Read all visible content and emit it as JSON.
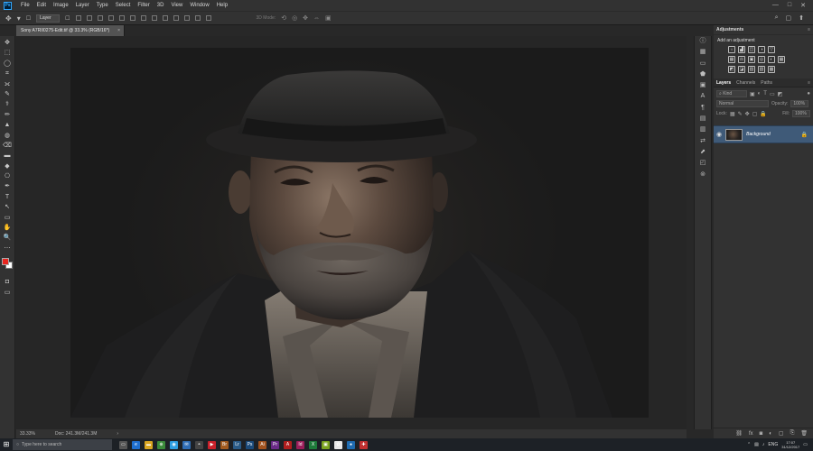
{
  "menubar": {
    "logo": "Ps",
    "items": [
      "File",
      "Edit",
      "Image",
      "Layer",
      "Type",
      "Select",
      "Filter",
      "3D",
      "View",
      "Window",
      "Help"
    ],
    "window_controls": [
      "—",
      "□",
      "✕"
    ]
  },
  "optionsbar": {
    "layer_select": "Layer",
    "mode_3d": "3D Mode:",
    "right_icons": [
      "⌕",
      "▢",
      "⬆"
    ]
  },
  "document": {
    "tab_title": "Sony A7RII0275-Edit.tif @ 33.3% (RGB/16*)",
    "close_glyph": "×",
    "zoom": "33.33%",
    "doc_info": "Doc: 241.3M/241.3M",
    "status_arrow": "›"
  },
  "tools": [
    "✥",
    "⬚",
    "◯",
    "⌗",
    "⟗",
    "✎",
    "⚕",
    "✏",
    "▲",
    "◍",
    "⌫",
    "▬",
    "◆",
    "⎔",
    "✒",
    "T",
    "↖",
    "▭",
    "✋",
    "🔍",
    "⋯"
  ],
  "strip_icons": [
    "ⓘ",
    "▦",
    "▭",
    "⬟",
    "▣",
    "A",
    "¶",
    "▤",
    "▥",
    "⇄",
    "⬈",
    "◰",
    "⊚"
  ],
  "adjustments": {
    "header": "Adjustments",
    "subtitle": "Add an adjustment",
    "row1": [
      "☼",
      "▟",
      "◫",
      "◑",
      "▽"
    ],
    "row2": [
      "▦",
      "⚖",
      "▣",
      "◎",
      "◐",
      "▦"
    ],
    "row3": [
      "◩",
      "◪",
      "▨",
      "▧",
      "▩"
    ]
  },
  "layers": {
    "tabs": [
      "Layers",
      "Channels",
      "Paths"
    ],
    "filter_kind": "⌕ Kind",
    "blend_mode": "Normal",
    "opacity_label": "Opacity:",
    "opacity_value": "100%",
    "lock_label": "Lock:",
    "fill_label": "Fill:",
    "fill_value": "100%",
    "layer_name": "Background",
    "footer_icons": [
      "⛓",
      "fx",
      "◙",
      "◐",
      "▢",
      "⎘",
      "🗑"
    ]
  },
  "taskbar": {
    "start": "⊞",
    "search_placeholder": "Type here to search",
    "search_icon": "○",
    "apps": [
      {
        "label": "▭",
        "color": "#555"
      },
      {
        "label": "e",
        "color": "#1e6fd0"
      },
      {
        "label": "▬",
        "color": "#d9a520"
      },
      {
        "label": "⊕",
        "color": "#3a8a3a"
      },
      {
        "label": "◉",
        "color": "#2e9de0"
      },
      {
        "label": "✉",
        "color": "#2f6db5"
      },
      {
        "label": "◓",
        "color": "#444"
      },
      {
        "label": "▶",
        "color": "#c8202a"
      },
      {
        "label": "Br",
        "color": "#a05a1e"
      },
      {
        "label": "Lr",
        "color": "#2a5a86"
      },
      {
        "label": "Ps",
        "color": "#1b4a7a"
      },
      {
        "label": "Ai",
        "color": "#a0521e"
      },
      {
        "label": "Pr",
        "color": "#6a2a86"
      },
      {
        "label": "A",
        "color": "#b01e1e"
      },
      {
        "label": "Id",
        "color": "#9a1e5a"
      },
      {
        "label": "X",
        "color": "#1e7a3a"
      },
      {
        "label": "▣",
        "color": "#7aa21e"
      },
      {
        "label": "✿",
        "color": "#e8e8e8"
      },
      {
        "label": "●",
        "color": "#1e6ab0"
      },
      {
        "label": "✚",
        "color": "#c03030"
      }
    ],
    "tray_icons": [
      "⌃",
      "▤",
      "♪",
      "ENG"
    ],
    "time": "17:07",
    "date": "31/12/2017",
    "notify": "▭"
  }
}
